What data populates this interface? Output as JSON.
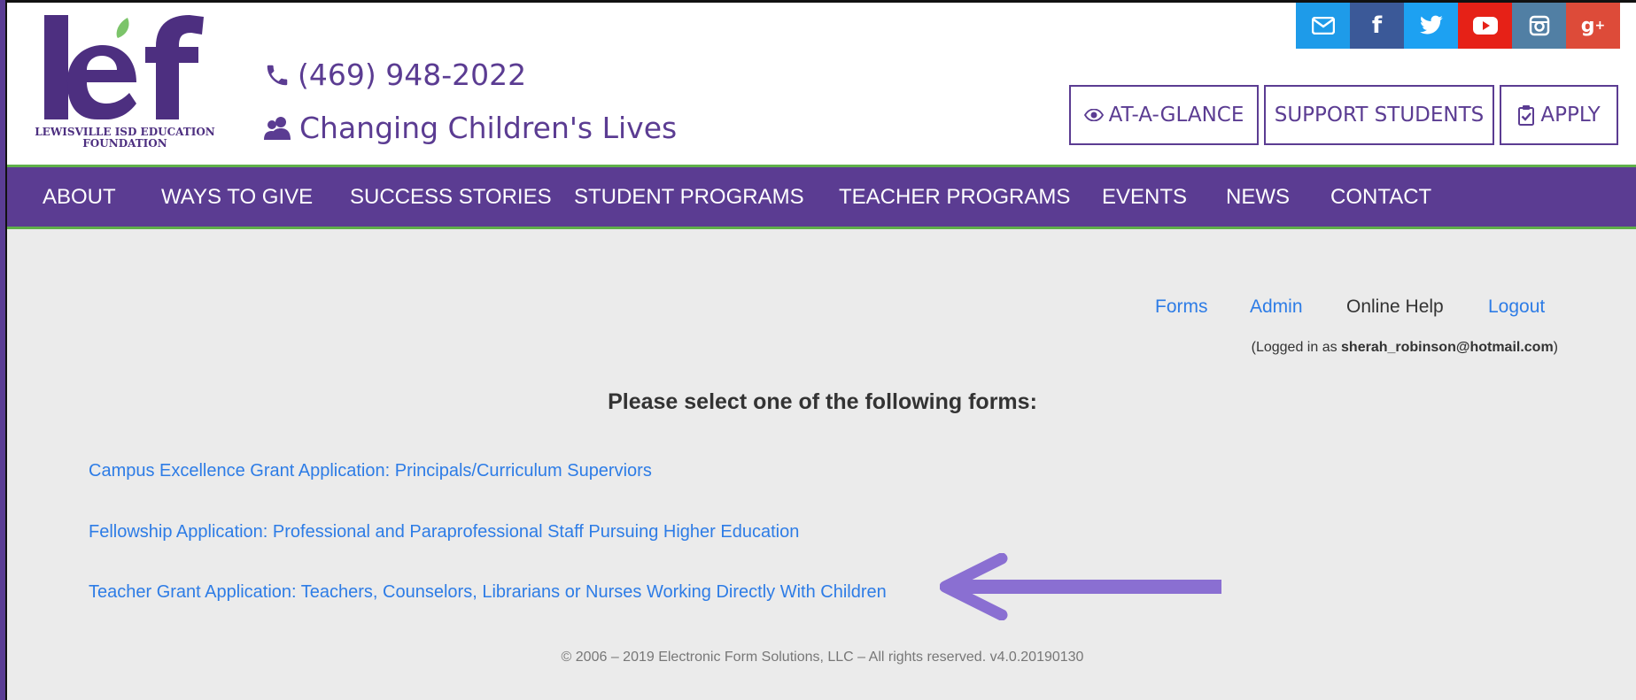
{
  "logo": {
    "letters": "lef",
    "text_line1": "LEWISVILLE ISD EDUCATION",
    "text_line2": "FOUNDATION",
    "color": "#4d2f80",
    "leaf_color": "#7cc46a"
  },
  "header": {
    "phone": "(469) 948-2022",
    "tagline": "Changing Children's Lives",
    "buttons": {
      "at_a_glance": "AT-A-GLANCE",
      "support_students": "SUPPORT STUDENTS",
      "apply": "APPLY"
    }
  },
  "social": [
    {
      "name": "email",
      "glyph": "✉",
      "color": "#1e9be9"
    },
    {
      "name": "facebook",
      "glyph": "f",
      "color": "#3b5998"
    },
    {
      "name": "twitter",
      "glyph": "t",
      "color": "#1da1f2"
    },
    {
      "name": "youtube",
      "glyph": "▶",
      "color": "#e62117"
    },
    {
      "name": "instagram",
      "glyph": "◎",
      "color": "#517fa4"
    },
    {
      "name": "google-plus",
      "glyph": "g+",
      "color": "#dd4b39"
    }
  ],
  "nav": [
    "ABOUT",
    "WAYS TO GIVE",
    "SUCCESS STORIES",
    "STUDENT PROGRAMS",
    "TEACHER PROGRAMS",
    "EVENTS",
    "NEWS",
    "CONTACT"
  ],
  "toplinks": {
    "forms": "Forms",
    "admin": "Admin",
    "online_help": "Online Help",
    "logout": "Logout"
  },
  "logged_in": {
    "prefix": "(Logged in as ",
    "email": "sherah_robinson@hotmail.com",
    "suffix": ")"
  },
  "main": {
    "heading": "Please select one of the following forms:",
    "forms": [
      "Campus Excellence Grant Application: Principals/Curriculum Superviors",
      "Fellowship Application: Professional and Paraprofessional Staff Pursuing Higher Education",
      "Teacher Grant Application: Teachers, Counselors, Librarians or Nurses Working Directly With Children"
    ]
  },
  "footer": "© 2006 – 2019 Electronic Form Solutions, LLC  –  All rights reserved.  v4.0.20190130",
  "colors": {
    "brand_purple": "#5b3c92",
    "accent_green": "#5fb04a",
    "link_blue": "#2d7ce6",
    "arrow": "#8a6fd2"
  }
}
